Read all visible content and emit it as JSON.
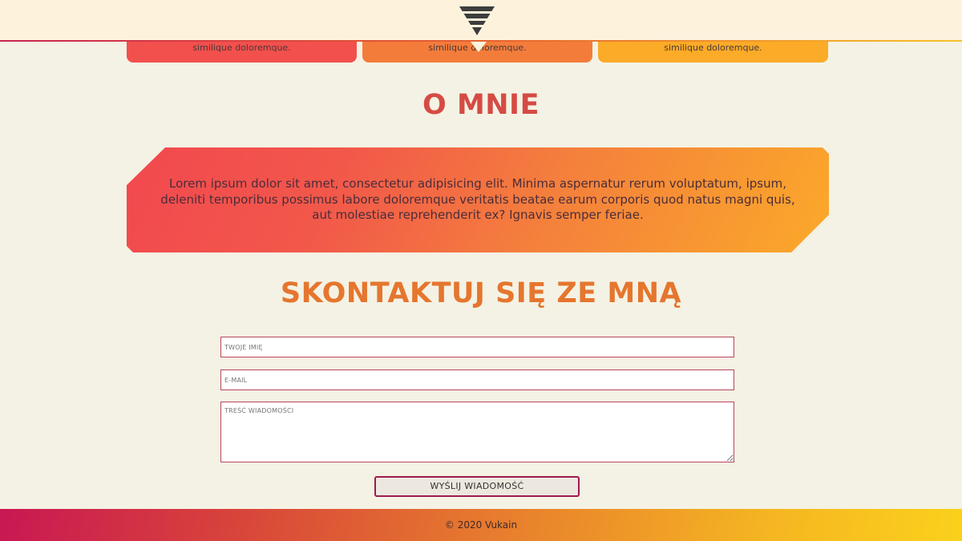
{
  "header": {
    "logo_icon": "inverted-triangle-stripes-icon"
  },
  "services": {
    "cards": [
      {
        "text": "similique doloremque."
      },
      {
        "text": "similique doloremque."
      },
      {
        "text": "similique doloremque."
      }
    ]
  },
  "about": {
    "title": "O MNIE",
    "text": "Lorem ipsum dolor sit amet, consectetur adipisicing elit. Minima aspernatur rerum voluptatum, ipsum, deleniti temporibus possimus labore doloremque veritatis beatae earum corporis quod natus magni quis, aut molestiae reprehenderit ex? Ignavis semper feriae."
  },
  "contact": {
    "title": "SKONTAKTUJ SIĘ ZE MNĄ",
    "name_placeholder": "TWOJE IMIĘ",
    "email_placeholder": "E-MAIL",
    "message_placeholder": "TREŚĆ WIADOMOŚCI",
    "submit_label": "WYŚLIJ WIADOMOŚĆ"
  },
  "footer": {
    "copyright": "© 2020 Vukain"
  },
  "colors": {
    "accent_red": "#d54b44",
    "accent_orange": "#e5762e",
    "border": "#b8465c",
    "background": "#f4f2e4"
  }
}
